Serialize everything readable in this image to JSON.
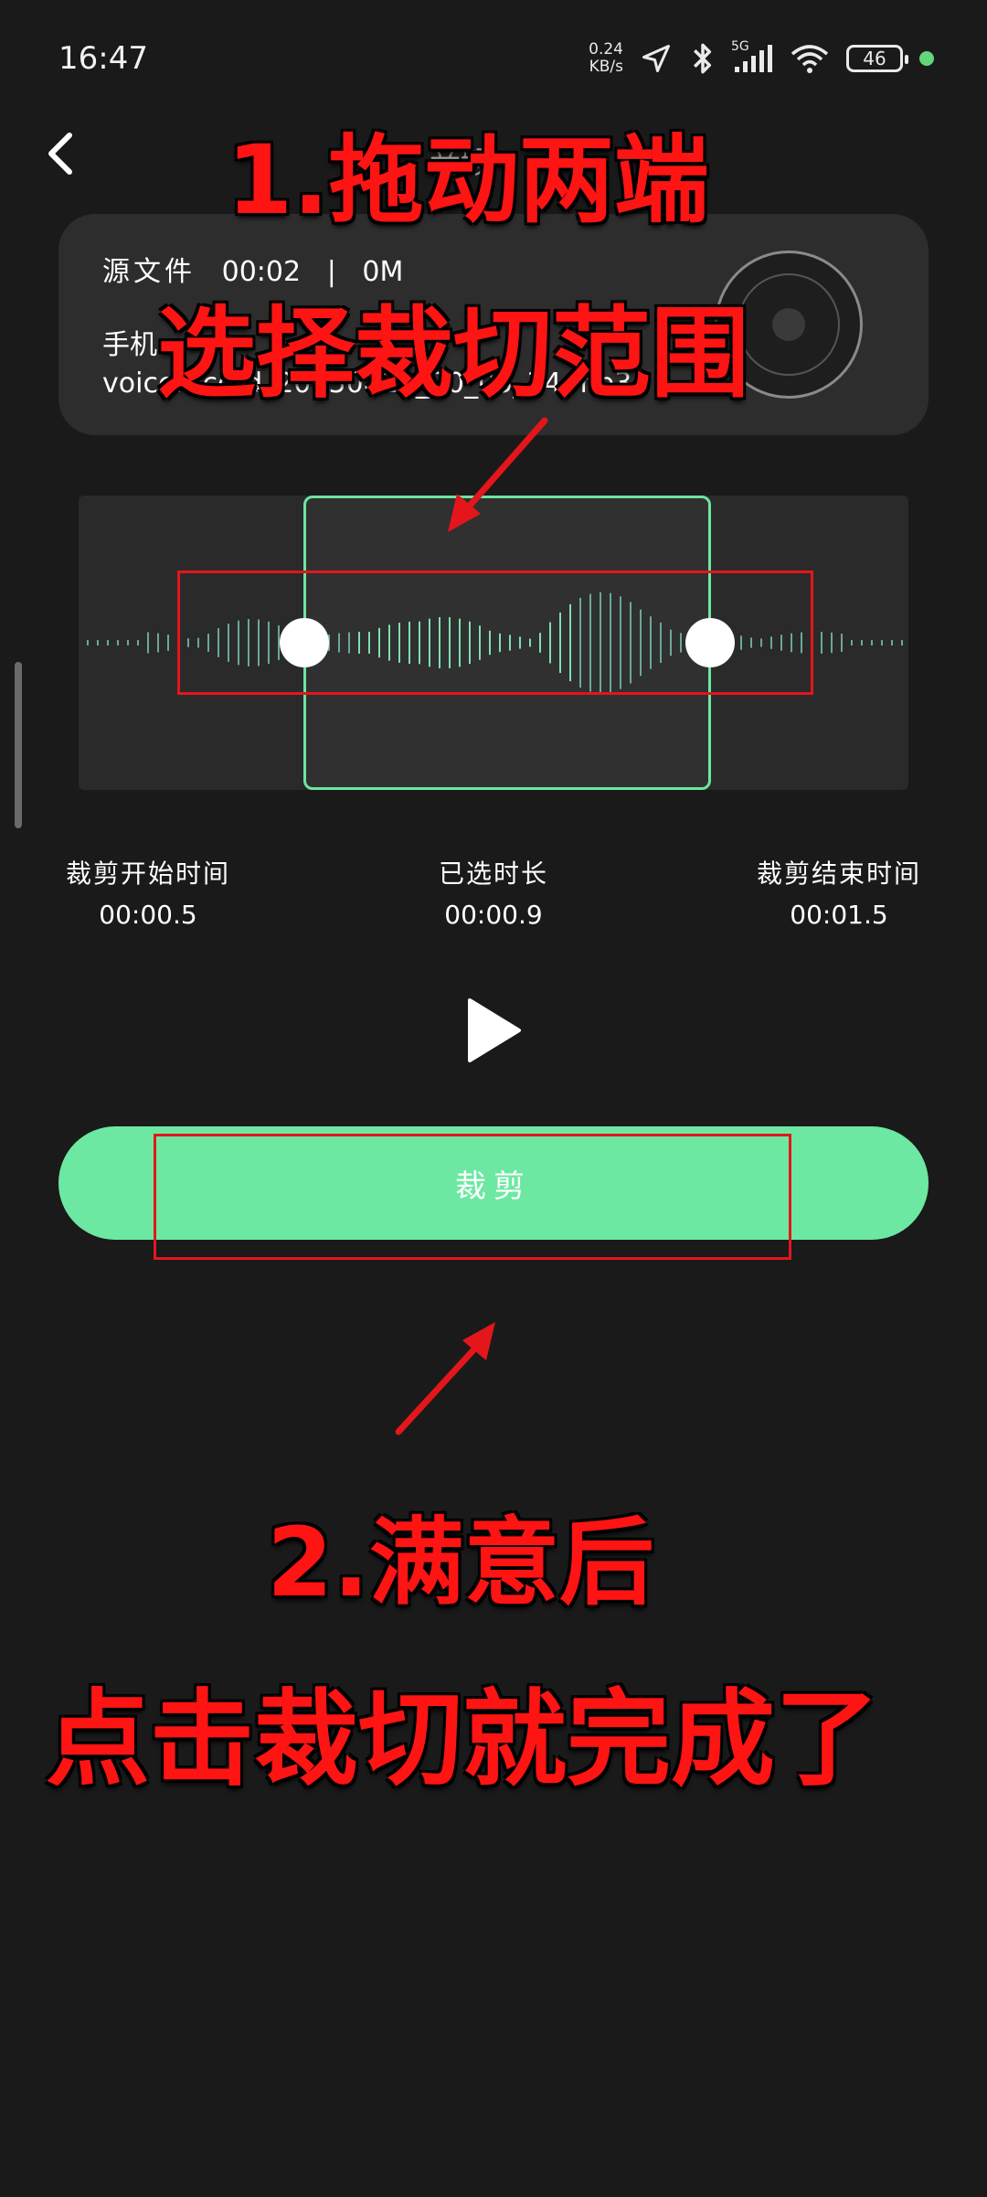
{
  "status_bar": {
    "time": "16:47",
    "net_speed_value": "0.24",
    "net_speed_unit": "KB/s",
    "network_type": "5G",
    "battery_level": "46",
    "icons": [
      "location-arrow-icon",
      "bluetooth-icon",
      "signal-icon",
      "wifi-icon",
      "battery-icon"
    ],
    "dot_color": "#63d57d"
  },
  "header": {
    "title_partial": "音频"
  },
  "file_info": {
    "source_label": "源文件",
    "duration": "00:02",
    "separator": "|",
    "size": "0M",
    "path_prefix": "手机",
    "filename": "voicerecord_20250829_20_05_34.mp3"
  },
  "waveform": {
    "selection_color": "#6ee5a0",
    "selection_start_fraction": 0.33,
    "selection_end_fraction": 0.6
  },
  "time_info": {
    "start_label": "裁剪开始时间",
    "start_value": "00:00.5",
    "selected_label": "已选时长",
    "selected_value": "00:00.9",
    "end_label": "裁剪结束时间",
    "end_value": "00:01.5"
  },
  "cut_button": {
    "label": "裁剪",
    "color": "#6de8a2"
  },
  "annotations": {
    "step1_line1": "1.拖动两端",
    "step1_line2": "选择裁切范围",
    "step2_line1": "2.满意后",
    "step2_line2": "点击裁切就完成了",
    "color": "#ff1414"
  }
}
